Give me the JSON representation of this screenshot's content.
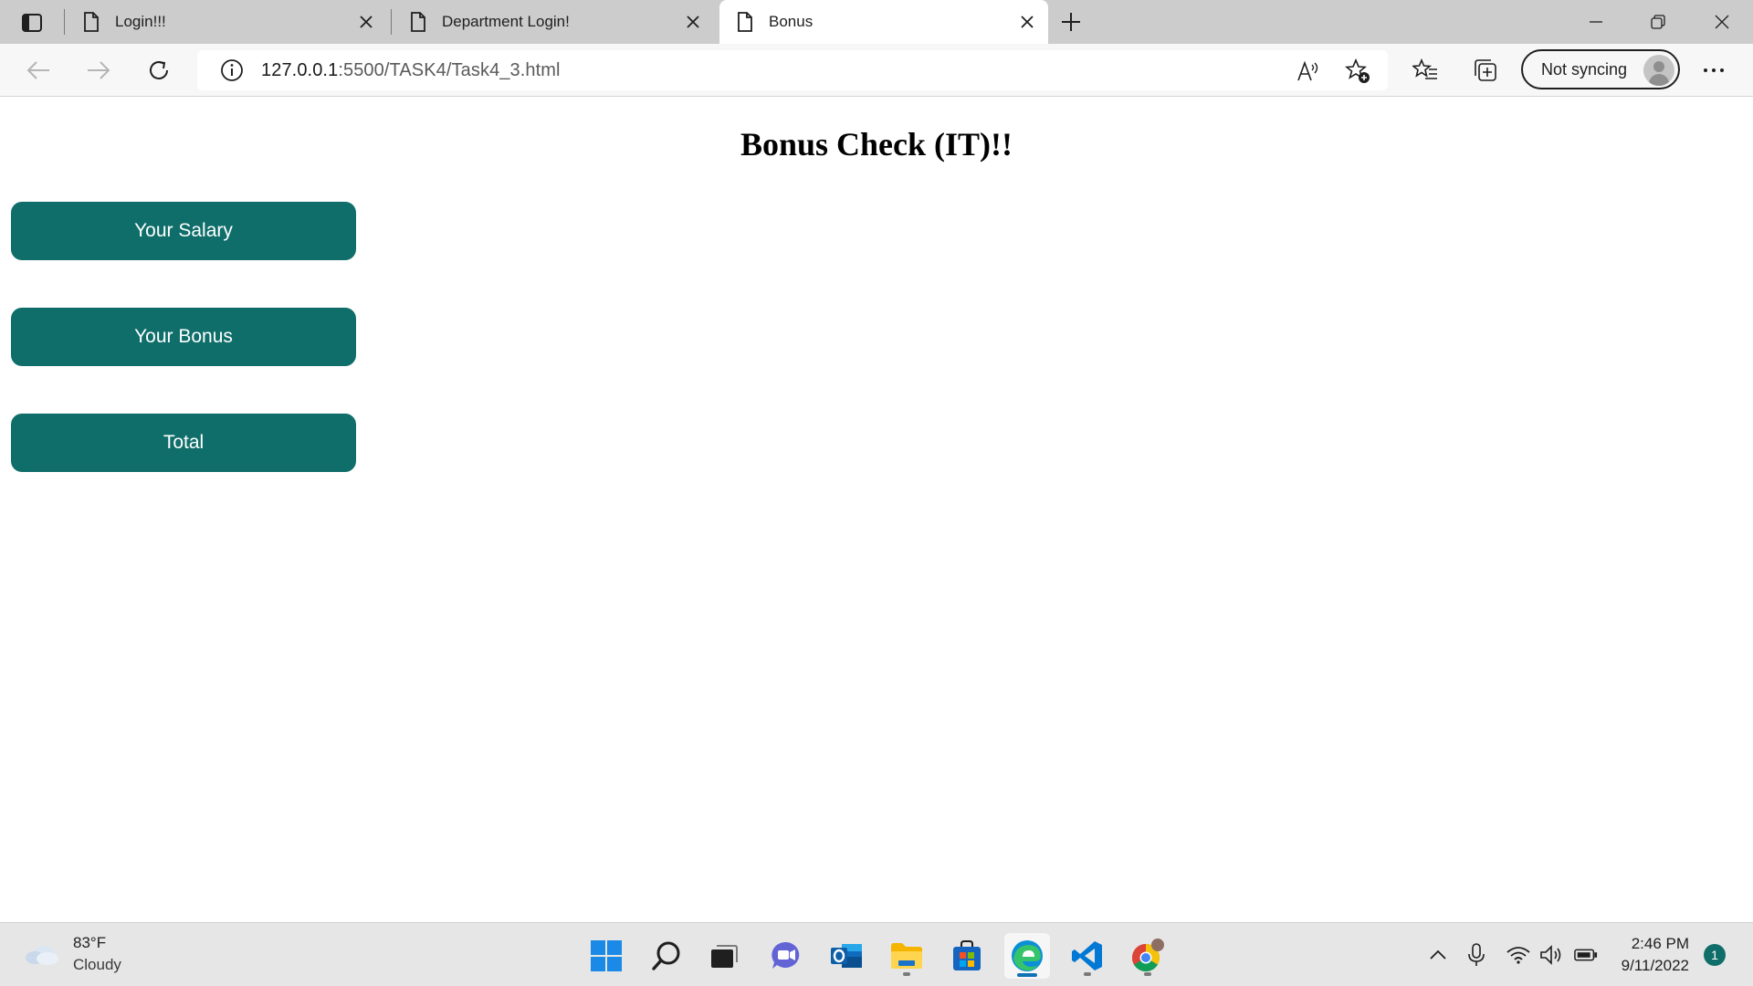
{
  "browser": {
    "tabs": [
      {
        "title": "Login!!!",
        "active": false
      },
      {
        "title": "Department Login!",
        "active": false
      },
      {
        "title": "Bonus",
        "active": true
      }
    ],
    "address": {
      "host": "127.0.0.1",
      "path": ":5500/TASK4/Task4_3.html"
    },
    "profile_label": "Not syncing"
  },
  "page": {
    "title": "Bonus Check (IT)!!",
    "buttons": [
      {
        "label": "Your Salary"
      },
      {
        "label": "Your Bonus"
      },
      {
        "label": "Total"
      }
    ],
    "button_color": "#0f6e6a"
  },
  "taskbar": {
    "weather": {
      "temp": "83°F",
      "condition": "Cloudy"
    },
    "apps": [
      "start-icon",
      "search-icon",
      "task-view-icon",
      "chat-icon",
      "outlook-icon",
      "file-explorer-icon",
      "store-icon",
      "edge-icon",
      "vscode-icon",
      "chrome-icon"
    ],
    "clock": {
      "time": "2:46 PM",
      "date": "9/11/2022"
    },
    "notification_count": "1"
  }
}
